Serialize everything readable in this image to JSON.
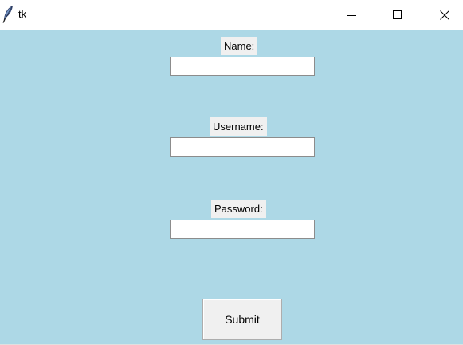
{
  "window": {
    "title": "tk",
    "icon": "feather-icon",
    "controls": [
      "minimize-icon",
      "maximize-icon",
      "close-icon"
    ]
  },
  "form": {
    "background": "#add8e6",
    "label_background": "#f0f0f0",
    "fields": [
      {
        "label": "Name:",
        "value": "",
        "placeholder": ""
      },
      {
        "label": "Username:",
        "value": "",
        "placeholder": ""
      },
      {
        "label": "Password:",
        "value": "",
        "placeholder": ""
      }
    ],
    "submit_label": "Submit"
  }
}
